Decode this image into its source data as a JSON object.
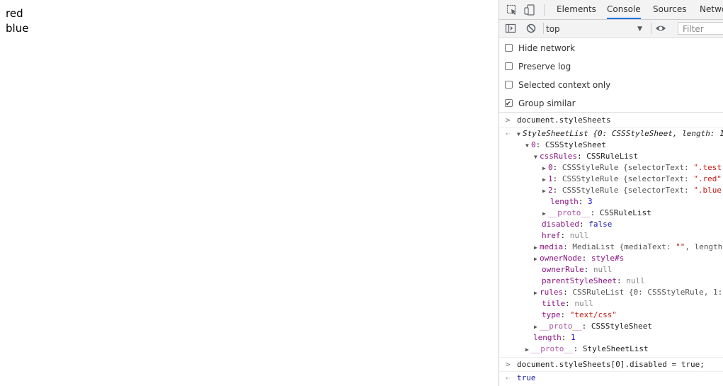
{
  "page": {
    "line1": "red",
    "line2": "blue"
  },
  "devtools": {
    "tabs": [
      "Elements",
      "Console",
      "Sources",
      "Netwo"
    ],
    "active_tab": "Console",
    "context": "top",
    "filter_placeholder": "Filter",
    "settings": [
      {
        "label": "Hide network",
        "checked": false
      },
      {
        "label": "Preserve log",
        "checked": false
      },
      {
        "label": "Selected context only",
        "checked": false
      },
      {
        "label": "Group similar",
        "checked": true
      }
    ],
    "console": {
      "cmd1": "document.styleSheets",
      "result_header": "StyleSheetList {0: CSSStyleSheet, length: 1",
      "item0_key": "0",
      "item0_val": "CSSStyleSheet",
      "cssRules_key": "cssRules",
      "cssRules_val": "CSSRuleList",
      "rule0_key": "0",
      "rule0_val": "CSSStyleRule {selectorText: ",
      "rule0_str": "\".test",
      "rule1_key": "1",
      "rule1_val": "CSSStyleRule {selectorText: ",
      "rule1_str": "\".red\"",
      "rule2_key": "2",
      "rule2_val": "CSSStyleRule {selectorText: ",
      "rule2_str": "\".blue",
      "length_key": "length",
      "length_val": "3",
      "proto1_key": "__proto__",
      "proto1_val": "CSSRuleList",
      "disabled_key": "disabled",
      "disabled_val": "false",
      "href_key": "href",
      "href_val": "null",
      "media_key": "media",
      "media_val": "MediaList {mediaText: ",
      "media_str": "\"\"",
      "media_tail": ", length",
      "owner_key": "ownerNode",
      "owner_val": "style#s",
      "ownerRule_key": "ownerRule",
      "ownerRule_val": "null",
      "parent_key": "parentStyleSheet",
      "parent_val": "null",
      "rules_key": "rules",
      "rules_val": "CSSRuleList {0: CSSStyleRule, 1:",
      "title_key": "title",
      "title_val": "null",
      "type_key": "type",
      "type_val": "\"text/css\"",
      "proto2_key": "__proto__",
      "proto2_val": "CSSStyleSheet",
      "len2_key": "length",
      "len2_val": "1",
      "proto3_key": "__proto__",
      "proto3_val": "StyleSheetList",
      "cmd2": "document.styleSheets[0].disabled = true;",
      "result2": "true"
    }
  }
}
